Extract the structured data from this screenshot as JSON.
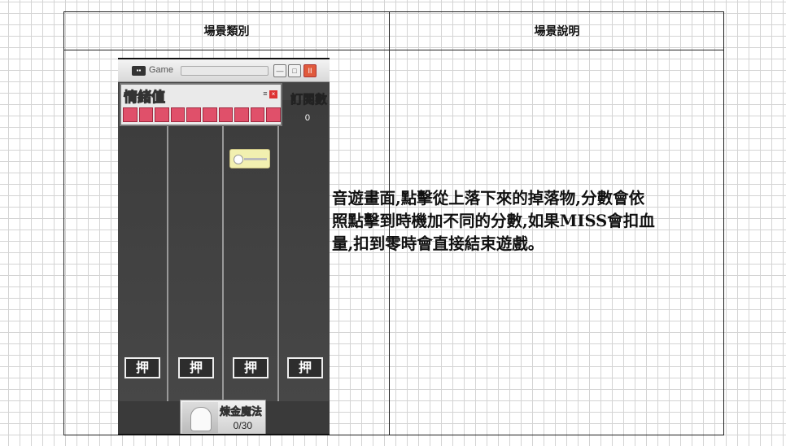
{
  "table": {
    "header_category": "場景類別",
    "header_description": "場景說明"
  },
  "game": {
    "window_title": "Game",
    "window_buttons": [
      "—",
      "□",
      "II"
    ],
    "mood_label": "情緒值",
    "mood_level": 1.0,
    "subscribers_label": "訂閱數",
    "subscribers_count": "0",
    "press_label": "押",
    "lanes": 4,
    "skill_title": "煉金魔法",
    "skill_progress": "0/30"
  },
  "description": "音遊畫面,點擊從上落下來的掉落物,分數會依照點擊到時機加不同的分數,如果MISS會扣血量,扣到零時會直接結束遊戲。",
  "colors": {
    "mood_bar": "#e0506a",
    "close_button": "#e05a3c",
    "grid_line": "#d4d4d4"
  }
}
